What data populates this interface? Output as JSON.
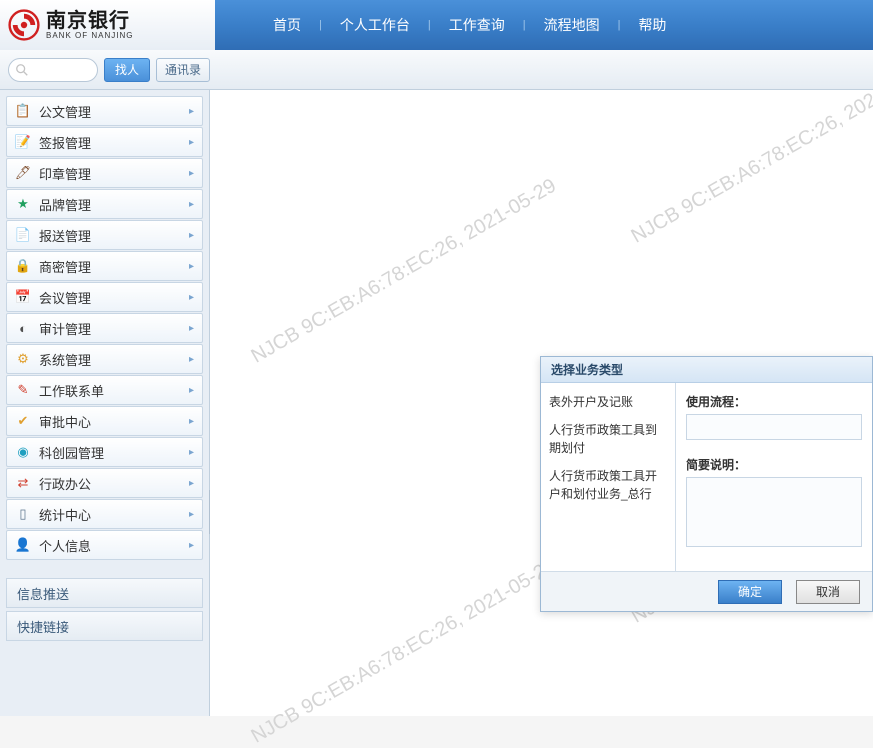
{
  "header": {
    "logo_cn": "南京银行",
    "logo_en": "BANK OF NANJING",
    "nav": [
      "首页",
      "个人工作台",
      "工作查询",
      "流程地图",
      "帮助"
    ]
  },
  "toolbar": {
    "search_placeholder": "",
    "find_label": "找人",
    "contacts_label": "通讯录"
  },
  "sidebar": {
    "items": [
      {
        "icon": "📋",
        "color": "#607890",
        "label": "公文管理"
      },
      {
        "icon": "📝",
        "color": "#e07030",
        "label": "签报管理"
      },
      {
        "icon": "🖊",
        "color": "#805030",
        "label": "印章管理"
      },
      {
        "icon": "★",
        "color": "#20a060",
        "label": "品牌管理"
      },
      {
        "icon": "📄",
        "color": "#d04030",
        "label": "报送管理"
      },
      {
        "icon": "🔒",
        "color": "#e07030",
        "label": "商密管理"
      },
      {
        "icon": "📅",
        "color": "#4080d0",
        "label": "会议管理"
      },
      {
        "icon": "◐",
        "color": "#505050",
        "label": "审计管理"
      },
      {
        "icon": "⚙",
        "color": "#e0a030",
        "label": "系统管理"
      },
      {
        "icon": "✎",
        "color": "#d04030",
        "label": "工作联系单"
      },
      {
        "icon": "✔",
        "color": "#e0a030",
        "label": "审批中心"
      },
      {
        "icon": "◉",
        "color": "#20a0c0",
        "label": "科创园管理"
      },
      {
        "icon": "⇄",
        "color": "#d04030",
        "label": "行政办公"
      },
      {
        "icon": "▯",
        "color": "#607890",
        "label": "统计中心"
      },
      {
        "icon": "👤",
        "color": "#4080d0",
        "label": "个人信息"
      }
    ],
    "panels": [
      "信息推送",
      "快捷链接"
    ]
  },
  "dialog": {
    "title": "选择业务类型",
    "biz_types": [
      "表外开户及记账",
      "人行货币政策工具到期划付",
      "人行货币政策工具开户和划付业务_总行"
    ],
    "field_process": "使用流程：",
    "field_desc": "简要说明：",
    "ok": "确定",
    "cancel": "取消"
  },
  "watermark": "NJCB 9C:EB:A6:78:EC:26, 2021-05-29"
}
